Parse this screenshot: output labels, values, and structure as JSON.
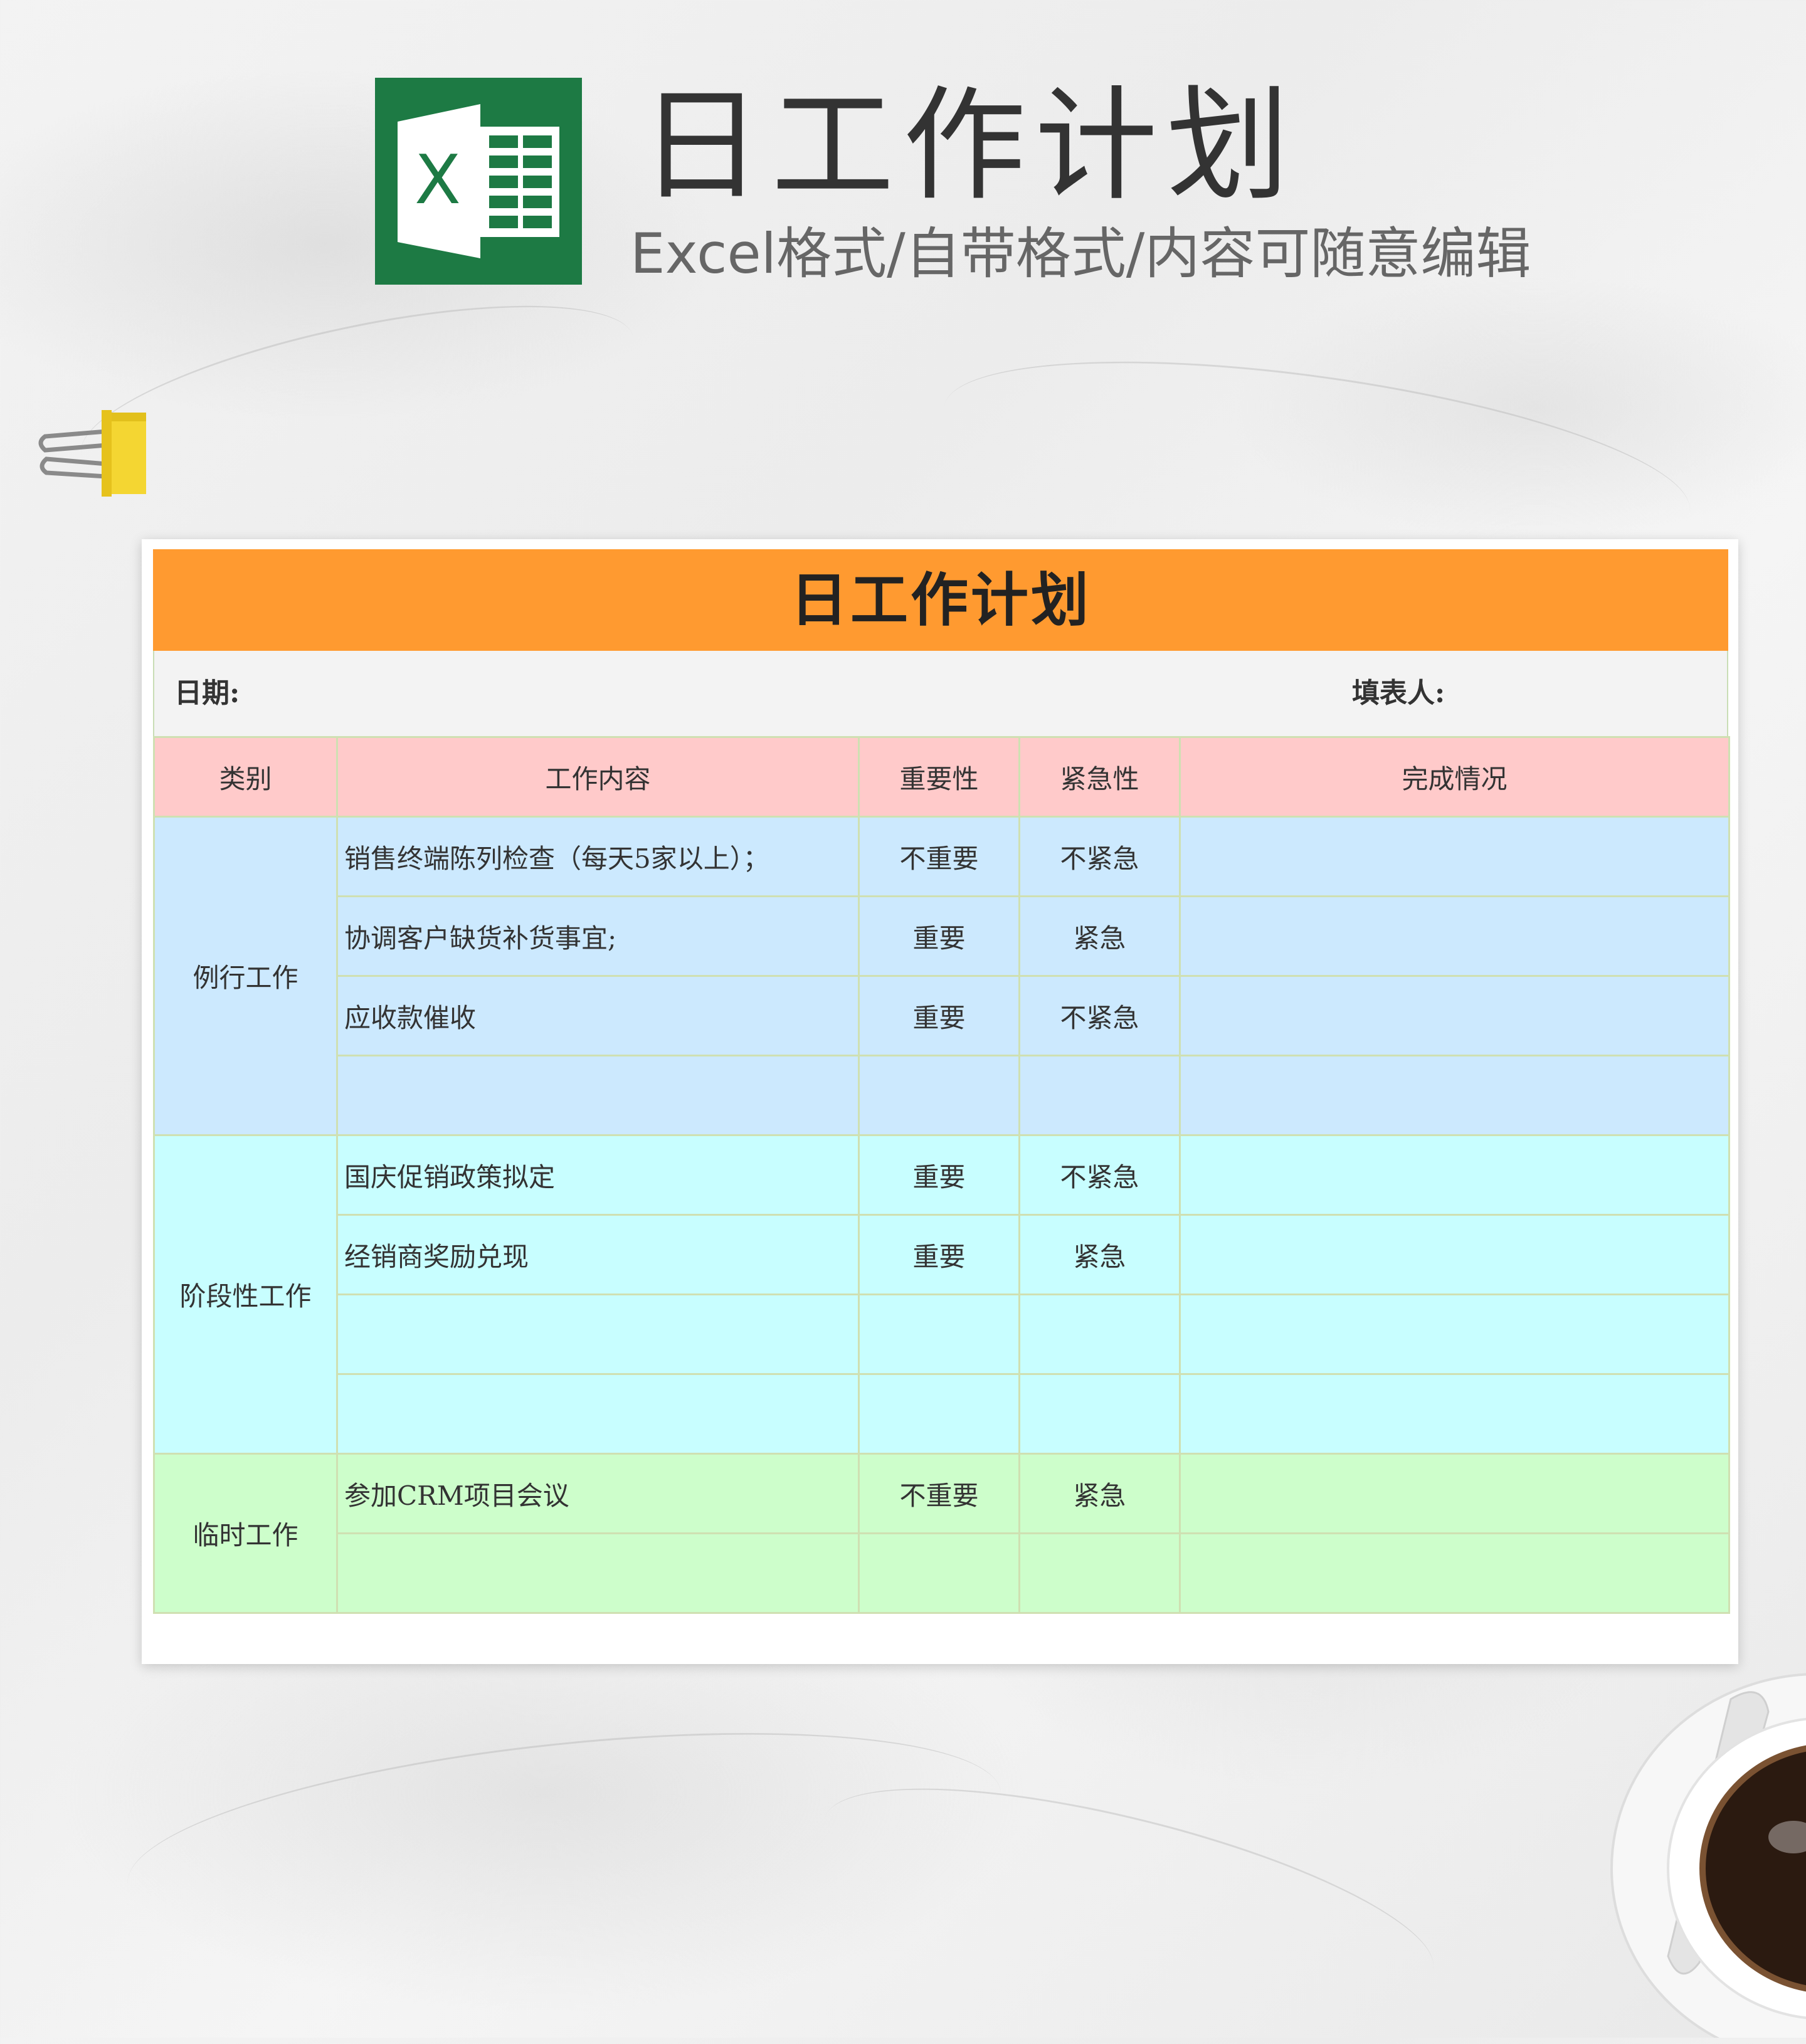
{
  "header": {
    "title": "日工作计划",
    "subtitle": "Excel格式/自带格式/内容可随意编辑",
    "logo_letter": "X"
  },
  "sheet": {
    "title": "日工作计划",
    "date_label": "日期:",
    "filler_label": "填表人:",
    "columns": [
      "类别",
      "工作内容",
      "重要性",
      "紧急性",
      "完成情况"
    ],
    "groups": [
      {
        "category": "例行工作",
        "rows": [
          {
            "content": "销售终端陈列检查（每天5家以上）；",
            "importance": "不重要",
            "urgency": "不紧急",
            "status": ""
          },
          {
            "content": "协调客户缺货补货事宜;",
            "importance": "重要",
            "urgency": "紧急",
            "status": ""
          },
          {
            "content": "应收款催收",
            "importance": "重要",
            "urgency": "不紧急",
            "status": ""
          },
          {
            "content": "",
            "importance": "",
            "urgency": "",
            "status": ""
          }
        ]
      },
      {
        "category": "阶段性工作",
        "rows": [
          {
            "content": "国庆促销政策拟定",
            "importance": "重要",
            "urgency": "不紧急",
            "status": ""
          },
          {
            "content": "经销商奖励兑现",
            "importance": "重要",
            "urgency": "紧急",
            "status": ""
          },
          {
            "content": "",
            "importance": "",
            "urgency": "",
            "status": ""
          },
          {
            "content": "",
            "importance": "",
            "urgency": "",
            "status": ""
          }
        ]
      },
      {
        "category": "临时工作",
        "rows": [
          {
            "content": "参加CRM项目会议",
            "importance": "不重要",
            "urgency": "紧急",
            "status": ""
          },
          {
            "content": "",
            "importance": "",
            "urgency": "",
            "status": ""
          }
        ]
      }
    ]
  },
  "colors": {
    "title_bar": "#ff9a30",
    "header_row": "#ffcaca",
    "routine_group": "#cce9fe",
    "phase_group": "#c8feff",
    "temp_group": "#cdfecb",
    "excel_green": "#1d7a44"
  },
  "decor": {
    "logo_icon": "excel-logo-icon",
    "clip_icon": "binder-clip-icon",
    "cup_icon": "coffee-cup-icon"
  }
}
